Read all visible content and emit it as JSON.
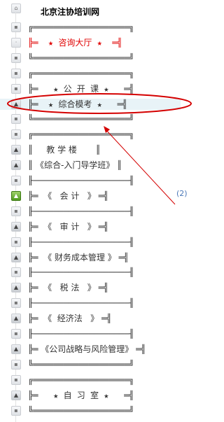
{
  "site_title": "北京注协培训网",
  "annotation_label": "(2)",
  "rows": [
    {
      "text": "╔═══════════════════╗",
      "icon": "lock-icon",
      "style": ""
    },
    {
      "text": "╠═  ★ 咨询大厅 ★  ═╣",
      "icon": "dot-icon",
      "style": "red"
    },
    {
      "text": "╚═══════════════════╝",
      "icon": "lock-icon",
      "style": ""
    },
    {
      "text": "╔═══════════════════╗",
      "icon": "lock-icon",
      "style": ""
    },
    {
      "text": "╠═   ★ 公 开 课 ★   ═╣",
      "icon": "lock-icon",
      "style": ""
    },
    {
      "text": "╠═  ★ 综合模考 ★   ═╣",
      "icon": "graduation-cap-icon",
      "style": "hl"
    },
    {
      "text": "╚═══════════════════╝",
      "icon": "lock-icon",
      "style": ""
    },
    {
      "text": "╔═══════════════════╗",
      "icon": "lock-icon",
      "style": ""
    },
    {
      "text": "║     教 学 楼       ║",
      "icon": "graduation-cap-icon",
      "style": "lbl"
    },
    {
      "text": "║ 《综合-入门导学班》 ║",
      "icon": "graduation-cap-icon",
      "style": "lbl"
    },
    {
      "text": "╟───────────────────╢",
      "icon": "lock-icon",
      "style": ""
    },
    {
      "text": "╠═  《   会 计   》 ═╣",
      "icon": "green-cap-icon",
      "style": "lbl"
    },
    {
      "text": "╟───────────────────╢",
      "icon": "lock-icon",
      "style": ""
    },
    {
      "text": "╠═  《   审 计   》 ═╣",
      "icon": "graduation-cap-icon",
      "style": "lbl"
    },
    {
      "text": "╟───────────────────╢",
      "icon": "lock-icon",
      "style": ""
    },
    {
      "text": "╠═  《 财务成本管理 》 ═╣",
      "icon": "graduation-cap-icon",
      "style": "lbl"
    },
    {
      "text": "╟───────────────────╢",
      "icon": "lock-icon",
      "style": ""
    },
    {
      "text": "╠═  《   税 法   》 ═╣",
      "icon": "graduation-cap-icon",
      "style": "lbl"
    },
    {
      "text": "╟───────────────────╢",
      "icon": "lock-icon",
      "style": ""
    },
    {
      "text": "╠═  《  经济法   》 ═╣",
      "icon": "graduation-cap-icon",
      "style": "lbl"
    },
    {
      "text": "╟───────────────────╢",
      "icon": "lock-icon",
      "style": ""
    },
    {
      "text": "╠═ 《公司战略与风险管理》 ═╣",
      "icon": "graduation-cap-icon",
      "style": "lbl"
    },
    {
      "text": "╚═══════════════════╝",
      "icon": "lock-icon",
      "style": ""
    },
    {
      "text": "╔═══════════════════╗",
      "icon": "lock-icon",
      "style": ""
    },
    {
      "text": "╠═   ★ 自 习 室 ★   ═╣",
      "icon": "graduation-cap-icon",
      "style": ""
    },
    {
      "text": "╚═══════════════════╝",
      "icon": "lock-icon",
      "style": ""
    }
  ]
}
